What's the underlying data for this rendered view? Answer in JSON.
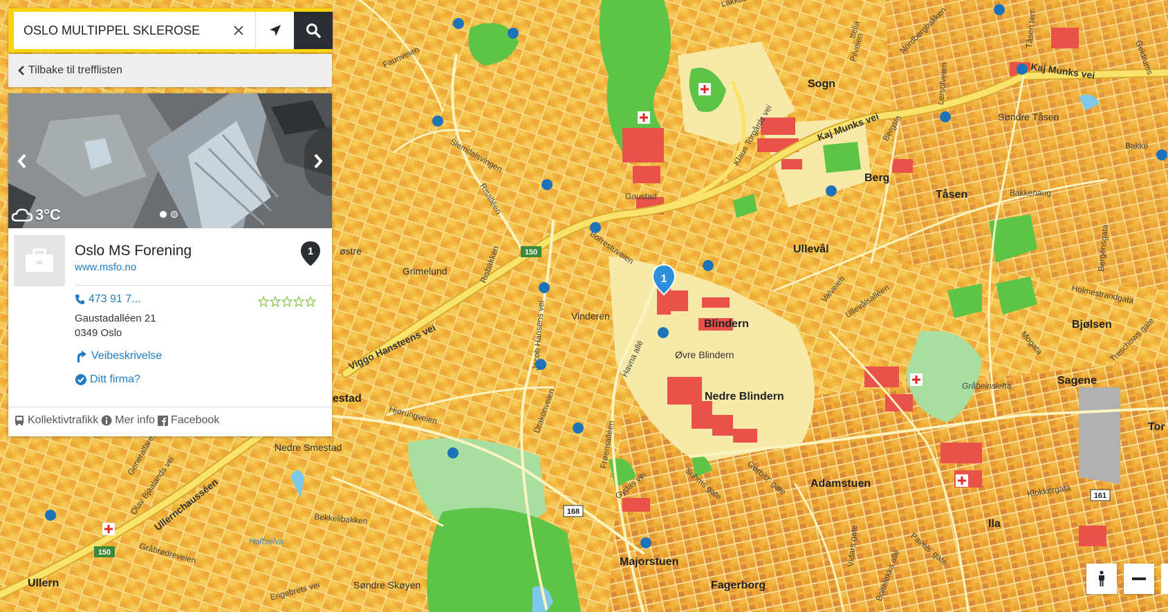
{
  "search": {
    "value": "OSLO MULTIPPEL SKLEROSE",
    "clear_icon": "close-icon",
    "locate_icon": "location-arrow-icon",
    "search_icon": "search-icon"
  },
  "back_link": {
    "label": "Tilbake til trefflisten",
    "icon": "chevron-left-icon"
  },
  "photo": {
    "weather_temp": "3°C",
    "weather_icon": "cloud-icon",
    "slides": 2,
    "active_slide": 1
  },
  "company": {
    "name": "Oslo MS Forening",
    "url": "www.msfo.no",
    "pin_number": "1",
    "phone": "473 91 7...",
    "address_line1": "Gaustadalléen 21",
    "address_line2": "0349 Oslo",
    "rating": 0,
    "rating_max": 5,
    "directions_label": "Veibeskrivelse",
    "claim_label": "Ditt firma?"
  },
  "footer": {
    "transit_label": "Kollektivtrafikk",
    "info_label": "Mer info",
    "facebook_label": "Facebook"
  },
  "map": {
    "marker_number": "1",
    "places": {
      "sogn": "Sogn",
      "berg": "Berg",
      "tasen": "Tåsen",
      "sondre_tasen": "Søndre Tåsen",
      "bakkehaug": "Bakkehaug",
      "bakke": "Bakke",
      "gaustad": "Gaustad",
      "ulleval": "Ullevål",
      "blindern": "Blindern",
      "ovre_blindern": "Øvre Blindern",
      "nedre_blindern": "Nedre Blindern",
      "vinderen": "Vinderen",
      "grimelund": "Grimelund",
      "bjolsen": "Bjølsen",
      "sagene": "Sagene",
      "tor": "Tor",
      "adamstuen": "Adamstuen",
      "ila": "Ila",
      "majorstuen": "Majorstuen",
      "fagerborg": "Fagerborg",
      "sondre_skoyen": "Søndre Skøyen",
      "ullern": "Ullern",
      "nedre_smestad": "Nedre Smestad",
      "smestad": "estad",
      "ostre": "østre",
      "grabeinsletta": "Gråbeinsletta",
      "hoffselva": "Hoffselva"
    },
    "roads": {
      "kaj_munks_vei_1": "Kaj Munks vei",
      "kaj_munks_vei_2": "Kaj Munks vei",
      "viggo_hansteens_vei": "Viggo Hansteens vei",
      "ullernchausseen": "Ullernchausséen",
      "slemdalsvingen": "Slemdalsvingen",
      "faunveien": "Faunveien",
      "risalleen": "Risalléen",
      "risbakken": "Risbakken",
      "borrestuveien": "Borrestuveien",
      "jacob_hansens_vei": "Jacob Hansens vei",
      "havna_alle": "Havna allé",
      "frognsaelleen": "Frøensalléen",
      "drakonveien": "Drakonveien",
      "hjorungveien": "Hjørungveien",
      "gydas_vei": "Gydas vei",
      "suhms_gate": "Suhms gate",
      "gorbitz_gate": "Gørbitz' gate",
      "vidars_gate": "Vidars gate",
      "pavels_gate": "Pavels' gate",
      "klokkergata": "Klokkergata",
      "ullevalsalleen": "Ullevålsalléen",
      "valveien": "Valveien",
      "mogata": "Mogata",
      "holmestrandgata": "Holmestrandgata",
      "bergensgata": "Bergensgata",
      "treschows_gate": "Treschows gate",
      "klaus_torgards_vei": "Klaus Torgårds vei",
      "bergsla": "Bergsla",
      "pilveien": "Pilveien",
      "nordbergbakken": "Nordbergbakken",
      "lersolveien": "Lersolveien",
      "grabrodreveien": "Gråbrødreveien",
      "bekkelibakken": "Bekkelibakken",
      "engebrets_vei": "Engebrets vei",
      "olav_bjaalands_vei": "Olav Bjaalands vei",
      "generalfaret": "Generalfaret",
      "bolteloekka_alle": "Bolteløkka allé",
      "lakkaskogen": "Lakkaskogen",
      "tasen_terr": "Tåsen terr",
      "geldrums": "Geldrums",
      "ostenveien": "ttelia"
    },
    "route_shields": [
      "150",
      "150",
      "168",
      "161"
    ]
  },
  "controls": {
    "pedestrian_icon": "pedestrian-icon",
    "zoom_out_icon": "minus-icon"
  },
  "colors": {
    "search_bar": "#f9d40c",
    "search_button": "#2a2e33",
    "link": "#1e7bc4",
    "map_base": "#f3c24a",
    "map_road": "#fbf3c0",
    "map_park": "#5ec447",
    "map_building": "#e8524a"
  }
}
